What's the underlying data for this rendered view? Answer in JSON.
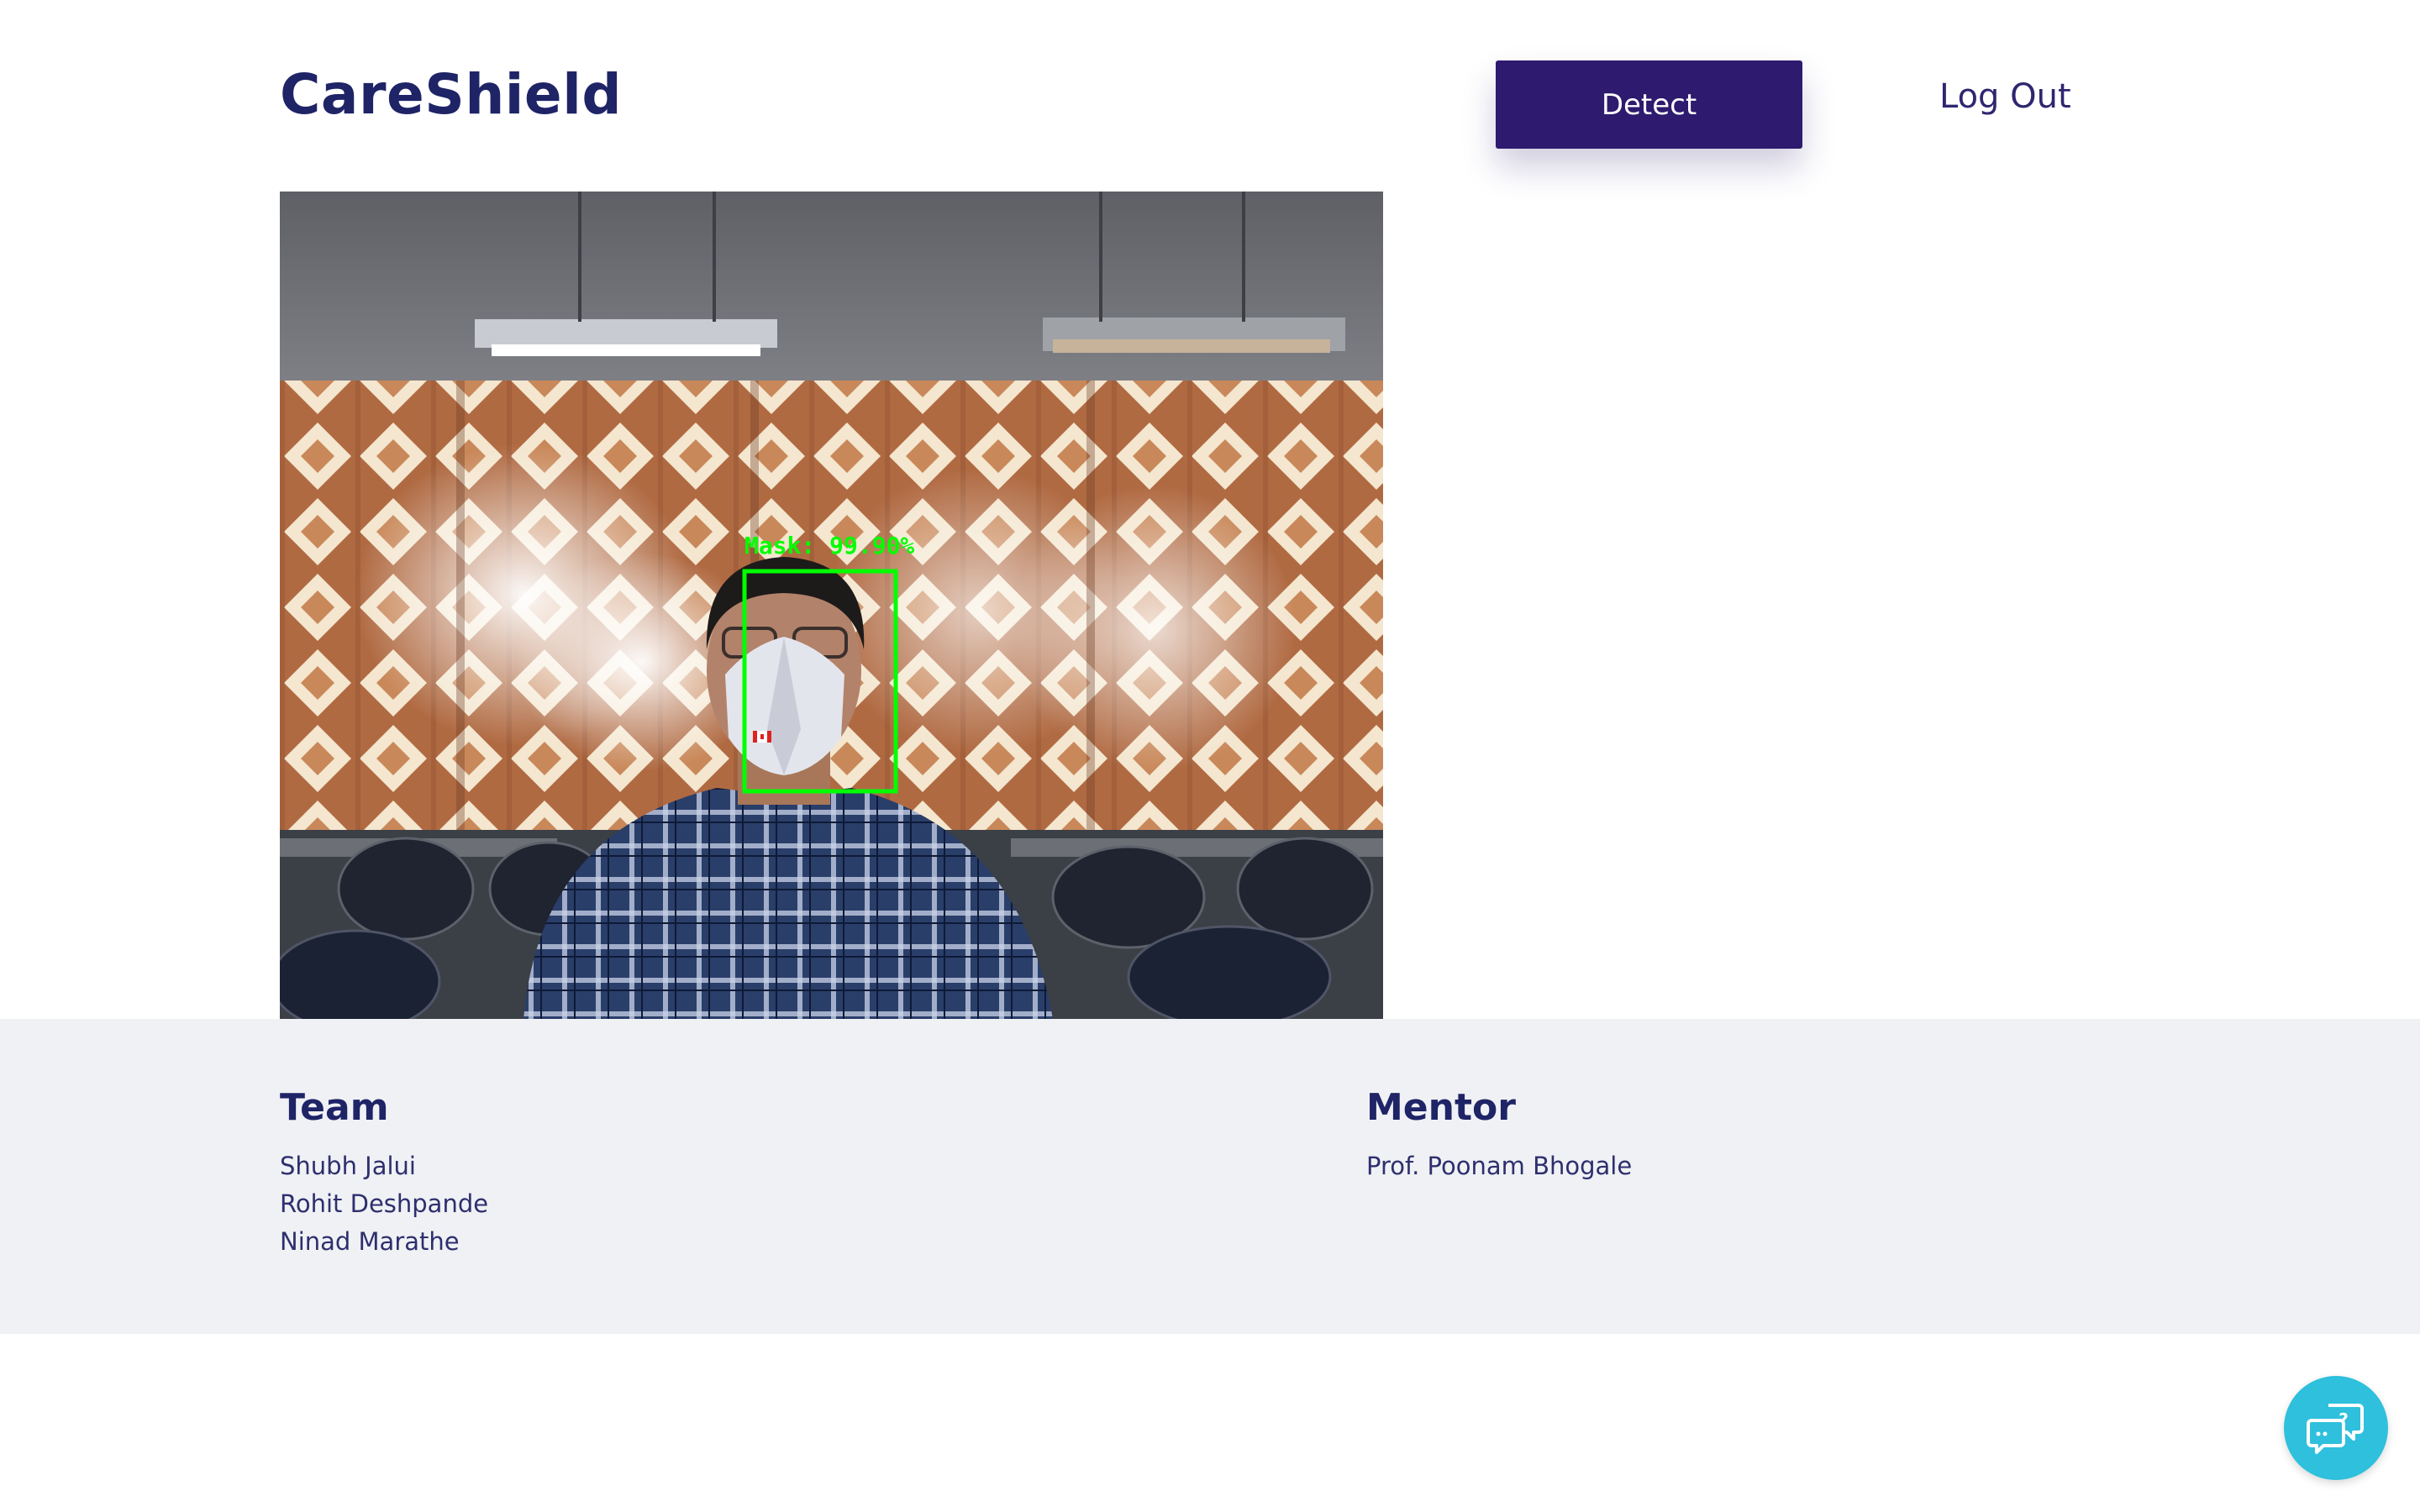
{
  "header": {
    "brand": "CareShield",
    "detect_label": "Detect",
    "logout_label": "Log Out"
  },
  "feed": {
    "detection_label": "Mask: 99.90%",
    "detection_color": "#00ff00"
  },
  "footer": {
    "team": {
      "heading": "Team",
      "members": [
        "Shubh Jalui",
        "Rohit Deshpande",
        "Ninad Marathe"
      ]
    },
    "mentor": {
      "heading": "Mentor",
      "name": "Prof. Poonam Bhogale"
    }
  },
  "chat": {
    "icon": "chat-help-icon"
  },
  "colors": {
    "brand": "#1e2466",
    "button": "#2e1a6e",
    "footer_bg": "#f0f1f4",
    "chat": "#2ec0dc"
  }
}
